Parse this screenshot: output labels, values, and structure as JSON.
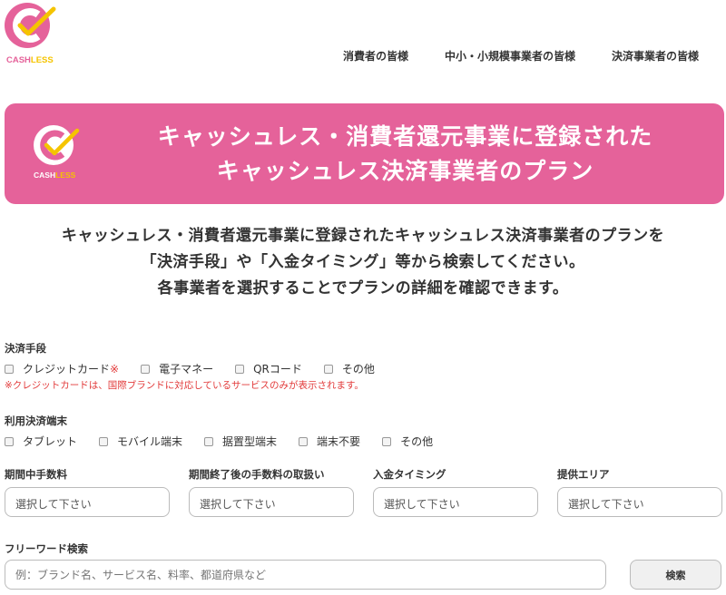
{
  "logo": {
    "text": "CASHLESS",
    "part_cash": "CASH",
    "part_less": "LESS",
    "color_circle": "#e5629a",
    "color_check": "#f5c400"
  },
  "nav": [
    {
      "label": "消費者の皆様"
    },
    {
      "label": "中小・小規模事業者の皆様"
    },
    {
      "label": "決済事業者の皆様"
    }
  ],
  "banner": {
    "line1": "キャッシュレス・消費者還元事業に登録された",
    "line2": "キャッシュレス決済事業者のプラン",
    "color": "#e5629a"
  },
  "intro": {
    "line1": "キャッシュレス・消費者還元事業に登録されたキャッシュレス決済事業者のプランを",
    "line2": "「決済手段」や「入金タイミング」等から検索してください。",
    "line3": "各事業者を選択することでプランの詳細を確認できます。"
  },
  "payment_method": {
    "label": "決済手段",
    "options": [
      {
        "label": "クレジットカード",
        "mark": "※"
      },
      {
        "label": "電子マネー"
      },
      {
        "label": "QRコード"
      },
      {
        "label": "その他"
      }
    ],
    "note": "※クレジットカードは、国際ブランドに対応しているサービスのみが表示されます。"
  },
  "terminal": {
    "label": "利用決済端末",
    "options": [
      {
        "label": "タブレット"
      },
      {
        "label": "モバイル端末"
      },
      {
        "label": "据置型端末"
      },
      {
        "label": "端末不要"
      },
      {
        "label": "その他"
      }
    ]
  },
  "selects": [
    {
      "label": "期間中手数料",
      "placeholder": "選択して下さい"
    },
    {
      "label": "期間終了後の手数料の取扱い",
      "placeholder": "選択して下さい"
    },
    {
      "label": "入金タイミング",
      "placeholder": "選択して下さい"
    },
    {
      "label": "提供エリア",
      "placeholder": "選択して下さい"
    }
  ],
  "free_word": {
    "label": "フリーワード検索",
    "placeholder": "例：ブランド名、サービス名、料率、都道府県など",
    "button": "検索"
  }
}
